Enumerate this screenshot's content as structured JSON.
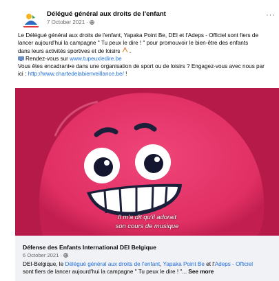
{
  "post": {
    "page_name": "Délégué général aux droits de l'enfant",
    "date": "7 October 2021",
    "separator": " · ",
    "more_label": "···",
    "text_line_1": "Le Délégué général aux droits de l'enfant, Yapaka Point Be, DEI et l'Adeps - Officiel sont fiers de",
    "text_line_2": "lancer aujourd'hui la campagne \" Tu peux le dire ! \" pour promouvoir le bien-être des enfants",
    "text_line_3": "dans leurs activités sportives et de loisirs",
    "text_line_3_end": " .",
    "visit_prefix": "Rendez-vous sur ",
    "visit_link": "www.tupeuxledire.be",
    "text_line_5": "Vous êtes encadrant•e dans une organisation de sport ou de loisirs ? Engagez-vous avec nous par",
    "text_line_6_prefix": "ici : ",
    "text_line_6_link": "http://www.chartedelabienveillance.be/",
    "text_line_6_end": " !"
  },
  "video": {
    "subtitle_line_1": "Il m'a dit qu'il adorait",
    "subtitle_line_2": "son cours de musique"
  },
  "shared": {
    "page_name": "Défense des Enfants International DEI Belgique",
    "date": "6 October 2021",
    "separator": " · ",
    "text_prefix": "DEI-Belgique, le ",
    "link_1": "Délégué général aux droits de l'enfant",
    "sep_1": ", ",
    "link_2": "Yapaka Point Be",
    "sep_2": " et l'",
    "link_3": "Adeps - Officiel",
    "text_line_2": "sont fiers de lancer aujourd'hui la campagne \" Tu peux le dire ! \"...",
    "see_more": "See more"
  },
  "colors": {
    "link": "#216fdb",
    "character": "#e7376b",
    "card_bg": "#f0f2f5"
  },
  "icons": {
    "avatar": "page-logo-icon",
    "globe": "globe-icon",
    "monitor": "monitor-icon",
    "sport": "sport-emoji-icon"
  }
}
